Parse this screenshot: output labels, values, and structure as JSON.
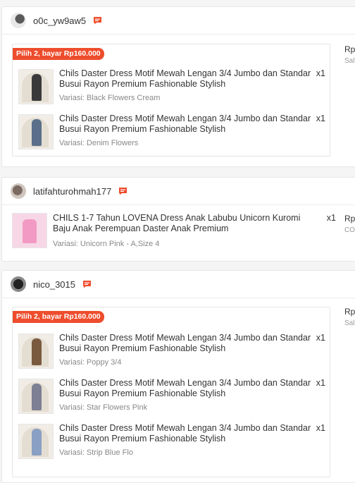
{
  "promo_label": "Pilih 2, bayar Rp160.000",
  "price_prefix": "Rp",
  "side_sub_1": "Sal",
  "side_sub_2": "CO",
  "shops": [
    {
      "name": "o0c_yw9aw5",
      "items": [
        {
          "title": "Chils Daster Dress Motif Mewah Lengan 3/4 Jumbo dan Standar Busui Rayon Premium Fashionable Stylish",
          "qty": "x1",
          "variant": "Variasi: Black Flowers Cream"
        },
        {
          "title": "Chils Daster Dress Motif Mewah Lengan 3/4 Jumbo dan Standar Busui Rayon Premium Fashionable Stylish",
          "qty": "x1",
          "variant": "Variasi: Denim Flowers"
        }
      ]
    },
    {
      "name": "latifahturohmah177",
      "items": [
        {
          "title": "CHILS 1-7 Tahun LOVENA Dress Anak Labubu Unicorn Kuromi Baju Anak Perempuan Daster Anak Premium",
          "qty": "x1",
          "variant": "Variasi: Unicorn Pink - A,Size 4"
        }
      ]
    },
    {
      "name": "nico_3015",
      "items": [
        {
          "title": "Chils Daster Dress Motif Mewah Lengan 3/4 Jumbo dan Standar Busui Rayon Premium Fashionable Stylish",
          "qty": "x1",
          "variant": "Variasi: Poppy 3/4"
        },
        {
          "title": "Chils Daster Dress Motif Mewah Lengan 3/4 Jumbo dan Standar Busui Rayon Premium Fashionable Stylish",
          "qty": "x1",
          "variant": "Variasi: Star Flowers Pink"
        },
        {
          "title": "Chils Daster Dress Motif Mewah Lengan 3/4 Jumbo dan Standar Busui Rayon Premium Fashionable Stylish",
          "qty": "x1",
          "variant": "Variasi: Strip Blue Flo"
        }
      ]
    }
  ],
  "colors": {
    "accent": "#ee4d2d",
    "chat_icon": "#ee4d2d"
  },
  "icons": {
    "chat": "chat-bubble-icon"
  }
}
